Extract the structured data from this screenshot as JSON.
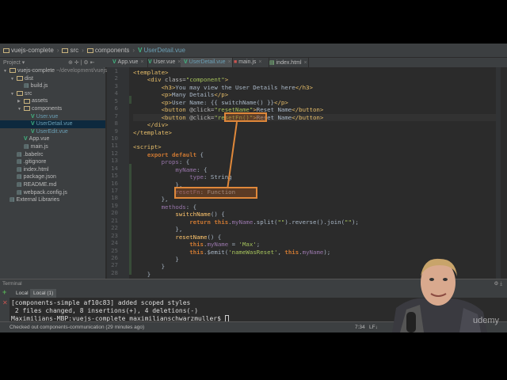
{
  "breadcrumb": [
    "vuejs-complete",
    "src",
    "components",
    "UserDetail.vue"
  ],
  "project_label": "Project",
  "tabs": [
    {
      "label": "App.vue"
    },
    {
      "label": "User.vue"
    },
    {
      "label": "UserDetail.vue",
      "active": true
    },
    {
      "label": "main.js"
    },
    {
      "label": "index.html"
    }
  ],
  "tree": [
    {
      "depth": 0,
      "arrow": "▼",
      "label": "vuejs-complete",
      "extra": " ~/development/vuejs"
    },
    {
      "depth": 1,
      "arrow": "▼",
      "label": "dist"
    },
    {
      "depth": 2,
      "arrow": "",
      "label": "build.js"
    },
    {
      "depth": 1,
      "arrow": "▼",
      "label": "src"
    },
    {
      "depth": 2,
      "arrow": "▶",
      "label": "assets"
    },
    {
      "depth": 2,
      "arrow": "▼",
      "label": "components"
    },
    {
      "depth": 3,
      "arrow": "",
      "label": "User.vue"
    },
    {
      "depth": 3,
      "arrow": "",
      "label": "UserDetail.vue",
      "selected": true
    },
    {
      "depth": 3,
      "arrow": "",
      "label": "UserEdit.vue"
    },
    {
      "depth": 2,
      "arrow": "",
      "label": "App.vue"
    },
    {
      "depth": 2,
      "arrow": "",
      "label": "main.js"
    },
    {
      "depth": 1,
      "arrow": "",
      "label": ".babelrc"
    },
    {
      "depth": 1,
      "arrow": "",
      "label": ".gitignore"
    },
    {
      "depth": 1,
      "arrow": "",
      "label": "index.html"
    },
    {
      "depth": 1,
      "arrow": "",
      "label": "package.json"
    },
    {
      "depth": 1,
      "arrow": "",
      "label": "README.md"
    },
    {
      "depth": 1,
      "arrow": "",
      "label": "webpack.config.js"
    },
    {
      "depth": 0,
      "arrow": "",
      "label": "External Libraries"
    }
  ],
  "code": [
    [
      [
        "<template>",
        "t"
      ]
    ],
    [
      [
        "    <div ",
        "t"
      ],
      [
        "class=",
        "a"
      ],
      [
        "\"component\"",
        "s"
      ],
      [
        ">",
        "t"
      ]
    ],
    [
      [
        "        <h3>",
        "t"
      ],
      [
        "You may view the User Details here",
        ""
      ],
      [
        "</h3>",
        "t"
      ]
    ],
    [
      [
        "        <p>",
        "t"
      ],
      [
        "Many Details",
        ""
      ],
      [
        "</p>",
        "t"
      ]
    ],
    [
      [
        "        <p>",
        "t"
      ],
      [
        "User Name: {{ switchName() }}",
        ""
      ],
      [
        "</p>",
        "t"
      ]
    ],
    [
      [
        "        <button ",
        "t"
      ],
      [
        "@click=",
        "a"
      ],
      [
        "\"resetName\"",
        "s"
      ],
      [
        ">",
        "t"
      ],
      [
        "Reset Name",
        ""
      ],
      [
        "</button>",
        "t"
      ]
    ],
    [
      [
        "        <button ",
        "t"
      ],
      [
        "@click=",
        "a"
      ],
      [
        "\"resetFn()\"",
        "s"
      ],
      [
        ">",
        "t"
      ],
      [
        "Reset Name",
        ""
      ],
      [
        "</button>",
        "t"
      ]
    ],
    [
      [
        "    </div>",
        "t"
      ]
    ],
    [
      [
        "</template>",
        "t"
      ]
    ],
    [
      [
        "",
        ""
      ]
    ],
    [
      [
        "<script>",
        "t"
      ]
    ],
    [
      [
        "    ",
        ""
      ],
      [
        "export default",
        "k"
      ],
      [
        " {",
        ""
      ]
    ],
    [
      [
        "        ",
        ""
      ],
      [
        "props",
        "p"
      ],
      [
        ": {",
        ""
      ]
    ],
    [
      [
        "            ",
        ""
      ],
      [
        "myName",
        "p"
      ],
      [
        ": {",
        ""
      ]
    ],
    [
      [
        "                ",
        ""
      ],
      [
        "type",
        "p"
      ],
      [
        ": String",
        ""
      ]
    ],
    [
      [
        "            },",
        ""
      ]
    ],
    [
      [
        "            ",
        ""
      ],
      [
        "resetFn",
        "p"
      ],
      [
        ": Function",
        ""
      ]
    ],
    [
      [
        "        },",
        ""
      ]
    ],
    [
      [
        "        ",
        ""
      ],
      [
        "methods",
        "p"
      ],
      [
        ": {",
        ""
      ]
    ],
    [
      [
        "            ",
        ""
      ],
      [
        "switchName",
        "f"
      ],
      [
        "() {",
        ""
      ]
    ],
    [
      [
        "                ",
        ""
      ],
      [
        "return this",
        "k"
      ],
      [
        ".",
        ""
      ],
      [
        "myName",
        "p"
      ],
      [
        ".split(",
        ""
      ],
      [
        "\"\"",
        "s"
      ],
      [
        ").reverse().join(",
        ""
      ],
      [
        "\"\"",
        "s"
      ],
      [
        ");",
        ""
      ]
    ],
    [
      [
        "            },",
        ""
      ]
    ],
    [
      [
        "            ",
        ""
      ],
      [
        "resetName",
        "f"
      ],
      [
        "() {",
        ""
      ]
    ],
    [
      [
        "                ",
        ""
      ],
      [
        "this",
        "k"
      ],
      [
        ".",
        ""
      ],
      [
        "myName",
        "p"
      ],
      [
        " = ",
        ""
      ],
      [
        "'Max'",
        "s"
      ],
      [
        ";",
        ""
      ]
    ],
    [
      [
        "                ",
        ""
      ],
      [
        "this",
        "k"
      ],
      [
        ".$emit(",
        ""
      ],
      [
        "'nameWasReset'",
        "s"
      ],
      [
        ", ",
        ""
      ],
      [
        "this",
        "k"
      ],
      [
        ".",
        ""
      ],
      [
        "myName",
        "p"
      ],
      [
        ");",
        ""
      ]
    ],
    [
      [
        "            }",
        ""
      ]
    ],
    [
      [
        "        }",
        ""
      ]
    ],
    [
      [
        "    }",
        ""
      ]
    ]
  ],
  "terminal": {
    "title": "Terminal",
    "tabs": [
      "Local",
      "Local (1)"
    ],
    "lines": [
      "[components-simple af10c83] added scoped styles",
      " 2 files changed, 8 insertions(+), 4 deletions(-)",
      "Maximilians-MBP:vuejs-complete maximilianschwarzmuller$ "
    ]
  },
  "status": {
    "message": "Checked out components-communication (29 minutes ago)",
    "position": "7:34",
    "eol": "LF↓",
    "watermark": "udemy"
  }
}
